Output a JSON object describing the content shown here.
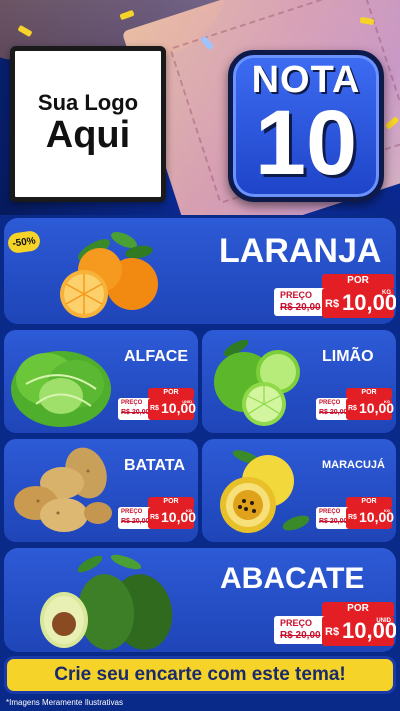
{
  "header": {
    "logo_line1": "Sua Logo",
    "logo_line2": "Aqui",
    "badge_word": "NOTA",
    "badge_number": "10"
  },
  "featured_top": {
    "name": "LARANJA",
    "discount": "-50%",
    "por": "POR",
    "preco": "PREÇO",
    "old_price": "R$ 20,00",
    "currency": "R$",
    "price": "10,00",
    "unit": "KG",
    "image_icon": "orange-fruit-icon"
  },
  "grid": [
    {
      "name": "ALFACE",
      "por": "POR",
      "preco": "PREÇO",
      "old_price": "R$ 20,00",
      "currency": "R$",
      "price": "10,00",
      "unit": "UNID",
      "image_icon": "lettuce-icon"
    },
    {
      "name": "LIMÃO",
      "por": "POR",
      "preco": "PREÇO",
      "old_price": "R$ 20,00",
      "currency": "R$",
      "price": "10,00",
      "unit": "KG",
      "image_icon": "lime-icon"
    },
    {
      "name": "BATATA",
      "por": "POR",
      "preco": "PREÇO",
      "old_price": "R$ 20,00",
      "currency": "R$",
      "price": "10,00",
      "unit": "KG",
      "image_icon": "potato-icon"
    },
    {
      "name": "MARACUJÁ",
      "por": "POR",
      "preco": "PREÇO",
      "old_price": "R$ 20,00",
      "currency": "R$",
      "price": "10,00",
      "unit": "KG",
      "image_icon": "passion-fruit-icon"
    }
  ],
  "featured_bottom": {
    "name": "ABACATE",
    "por": "POR",
    "preco": "PREÇO",
    "old_price": "R$ 20,00",
    "currency": "R$",
    "price": "10,00",
    "unit": "UNID",
    "image_icon": "avocado-icon"
  },
  "cta": "Crie seu encarte com este tema!",
  "footnote": "*Imagens Meramente Ilustrativas",
  "colors": {
    "panel_blue": "#2d5ad6",
    "price_red": "#e31e24",
    "cta_yellow": "#f6d328",
    "discount_yellow": "#f6d328"
  }
}
